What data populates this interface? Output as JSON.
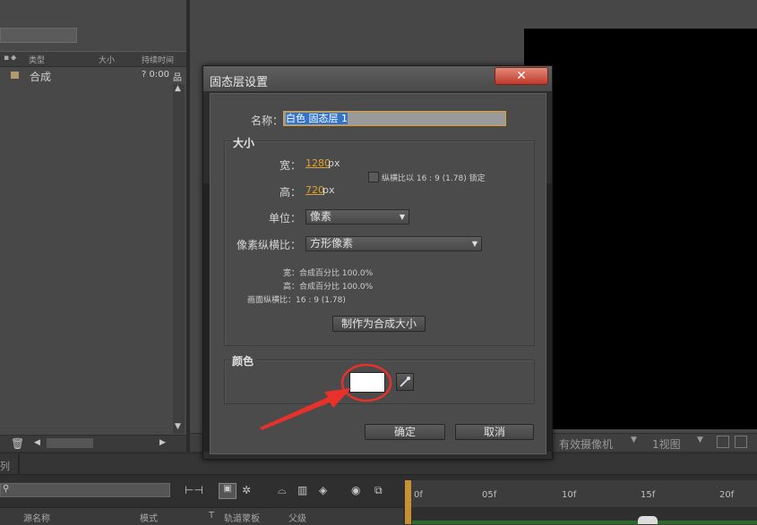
{
  "project": {
    "columns": {
      "type": "类型",
      "size": "大小",
      "duration": "持续时间"
    },
    "item": {
      "name": "合成",
      "duration": "? 0:00"
    }
  },
  "viewer": {
    "camera": "有效摄像机",
    "views": "1视图"
  },
  "timeline": {
    "tab": "列",
    "columns": {
      "source": "源名称",
      "mode": "模式",
      "t": "T",
      "trkmat": "轨道蒙板",
      "parent": "父级"
    },
    "ruler": [
      "0f",
      "05f",
      "10f",
      "15f",
      "20f"
    ]
  },
  "dialog": {
    "title": "固态层设置",
    "close": "✕",
    "name_label": "名称：",
    "name_value": "白色 固态层 1",
    "size_group": "大小",
    "width_label": "宽：",
    "width_value": "1280",
    "width_unit": "px",
    "height_label": "高：",
    "height_value": "720",
    "height_unit": "px",
    "lock_label": "纵横比以 16 : 9 (1.78) 锁定",
    "units_label": "单位：",
    "units_value": "像素",
    "par_label": "像素纵横比：",
    "par_value": "方形像素",
    "info_width": "宽：合成百分比 100.0%",
    "info_height": "高：合成百分比 100.0%",
    "info_frame": "画面纵横比：16 : 9 (1.78)",
    "make_comp_size": "制作为合成大小",
    "color_group": "颜色",
    "ok": "确定",
    "cancel": "取消"
  },
  "colors": {
    "swatch": "#ffffff",
    "accent": "#e39e2c",
    "close": "#c0392b",
    "annotation": "#e8312a"
  }
}
